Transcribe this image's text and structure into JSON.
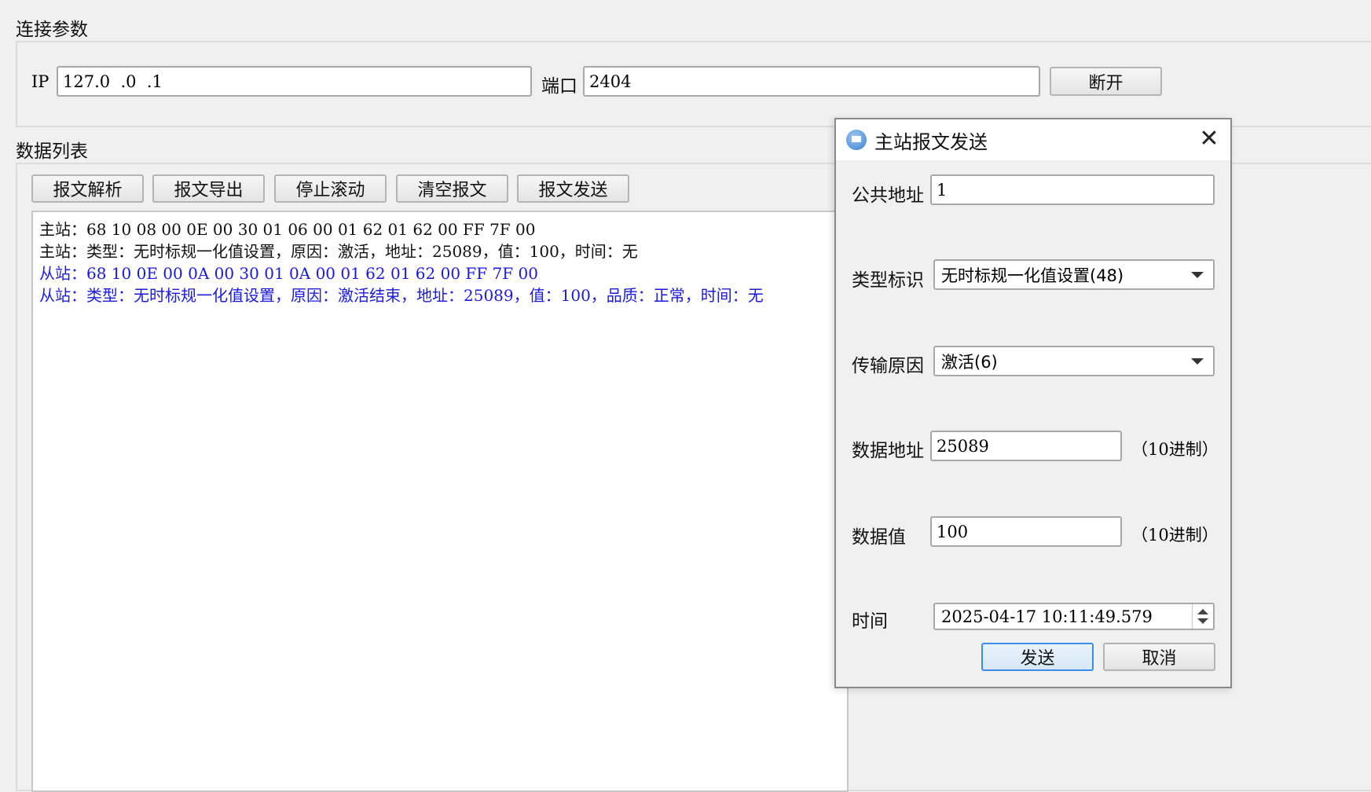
{
  "connection": {
    "section_title": "连接参数",
    "ip_label": "IP",
    "ip_value": "127.0  .0  .1",
    "port_label": "端口",
    "port_value": "2404",
    "disconnect_label": "断开"
  },
  "data_list": {
    "section_title": "数据列表",
    "toolbar": {
      "parse_label": "报文解析",
      "export_label": "报文导出",
      "stop_scroll_label": "停止滚动",
      "clear_label": "清空报文",
      "send_label": "报文发送"
    },
    "log_lines": [
      {
        "text": "主站：68 10 08 00 0E 00 30 01 06 00 01 62 01 62 00 FF 7F 00",
        "source": "master"
      },
      {
        "text": "主站：类型：无时标规一化值设置，原因：激活，地址：25089，值：100，时间：无",
        "source": "master"
      },
      {
        "text": "从站：68 10 0E 00 0A 00 30 01 0A 00 01 62 01 62 00 FF 7F 00",
        "source": "slave"
      },
      {
        "text": "从站：类型：无时标规一化值设置，原因：激活结束，地址：25089，值：100，品质：正常，时间：无",
        "source": "slave"
      }
    ]
  },
  "dialog": {
    "title": "主站报文发送",
    "common_address_label": "公共地址",
    "common_address_value": "1",
    "type_id_label": "类型标识",
    "type_id_value": "无时标规一化值设置(48)",
    "cause_label": "传输原因",
    "cause_value": "激活(6)",
    "data_address_label": "数据地址",
    "data_address_value": "25089",
    "data_address_unit": "（10进制）",
    "data_value_label": "数据值",
    "data_value_value": "100",
    "data_value_unit": "（10进制）",
    "time_label": "时间",
    "time_value": "2025-04-17 10:11:49.579",
    "send_label": "发送",
    "cancel_label": "取消"
  },
  "colors": {
    "slave_text": "#1a1ae0",
    "primary_button_border": "#3b8ee6"
  },
  "icons": {
    "app": "monitor-app-icon",
    "close": "close-icon"
  }
}
